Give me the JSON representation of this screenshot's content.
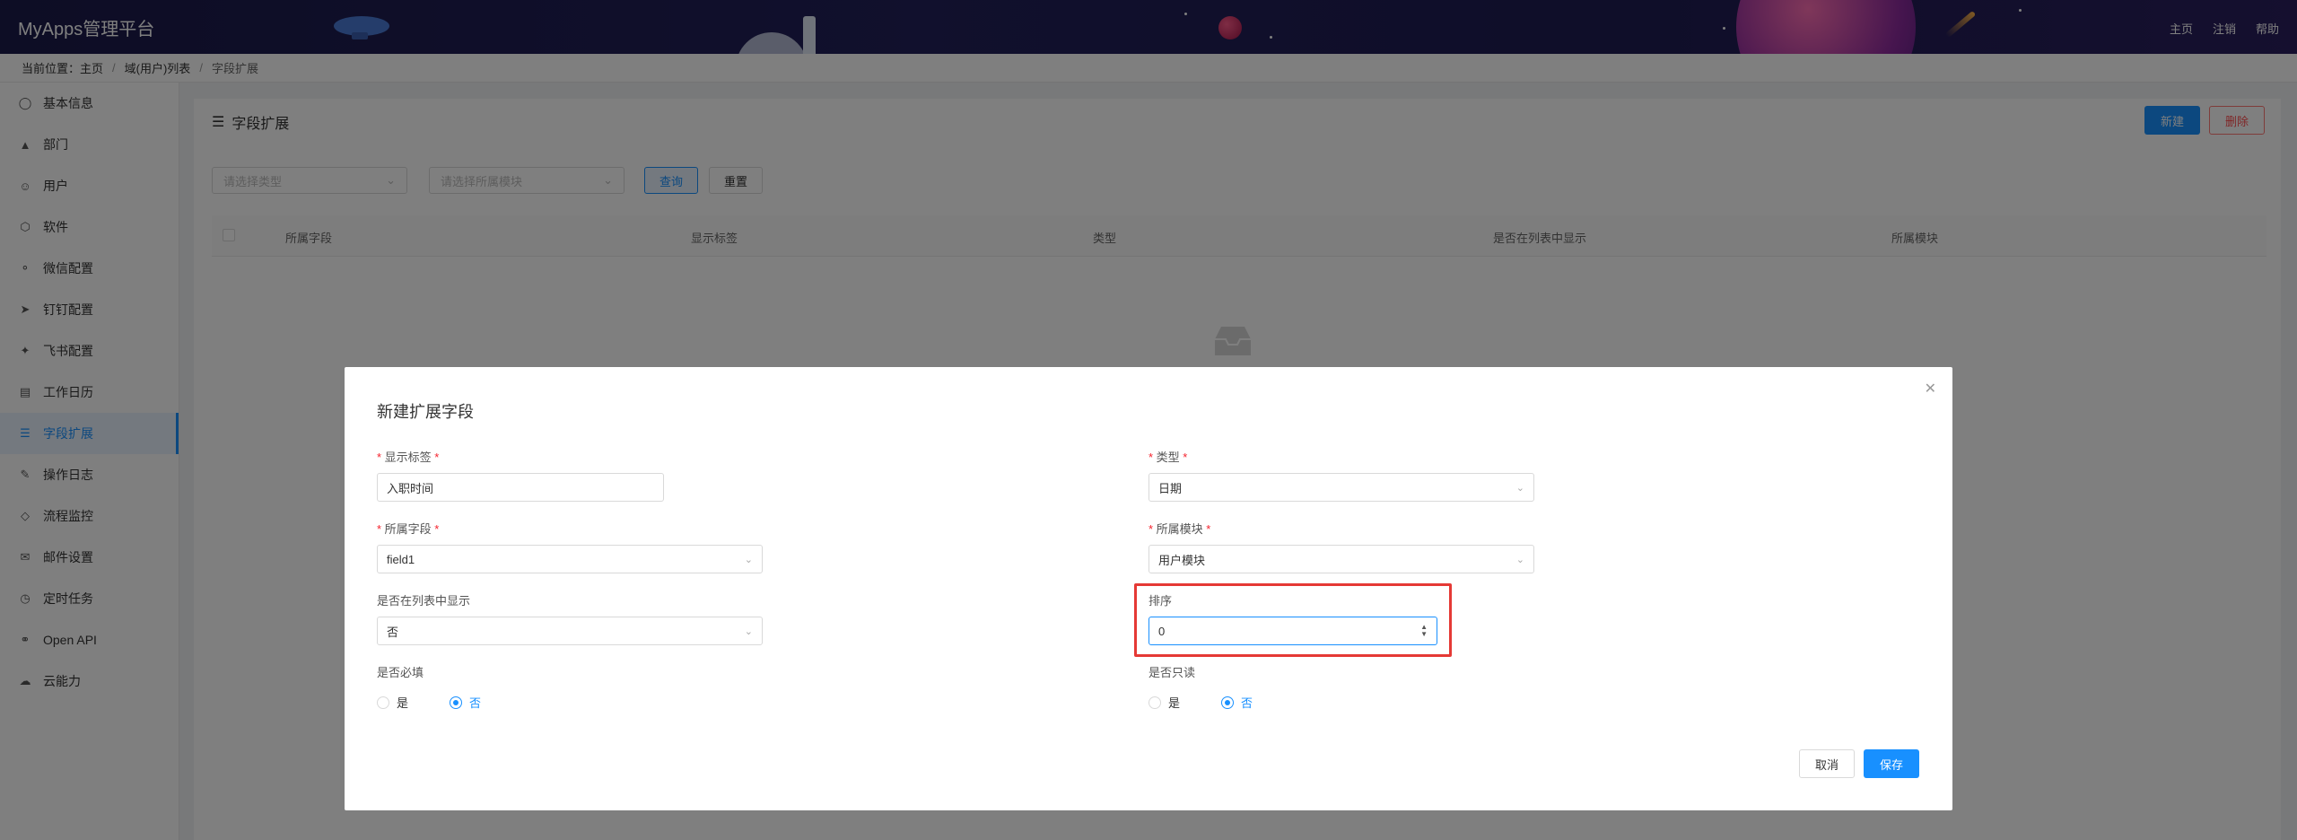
{
  "header": {
    "brand": "MyApps管理平台",
    "links": [
      "主页",
      "注销",
      "帮助"
    ]
  },
  "breadcrumb": {
    "prefix": "当前位置：主页",
    "items": [
      "域(用户)列表",
      "字段扩展"
    ]
  },
  "sidebar": {
    "items": [
      {
        "label": "基本信息",
        "icon": "user-icon"
      },
      {
        "label": "部门",
        "icon": "org-icon"
      },
      {
        "label": "用户",
        "icon": "users-icon"
      },
      {
        "label": "软件",
        "icon": "cube-icon"
      },
      {
        "label": "微信配置",
        "icon": "wechat-icon"
      },
      {
        "label": "钉钉配置",
        "icon": "dingtalk-icon"
      },
      {
        "label": "飞书配置",
        "icon": "feishu-icon"
      },
      {
        "label": "工作日历",
        "icon": "calendar-icon"
      },
      {
        "label": "字段扩展",
        "icon": "sliders-icon"
      },
      {
        "label": "操作日志",
        "icon": "log-icon"
      },
      {
        "label": "流程监控",
        "icon": "diamond-icon"
      },
      {
        "label": "邮件设置",
        "icon": "mail-icon"
      },
      {
        "label": "定时任务",
        "icon": "clock-icon"
      },
      {
        "label": "Open API",
        "icon": "link-icon"
      },
      {
        "label": "云能力",
        "icon": "cloud-icon"
      }
    ],
    "active_index": 8
  },
  "main": {
    "title": "字段扩展",
    "new_label": "新建",
    "delete_label": "删除",
    "filter_type_placeholder": "请选择类型",
    "filter_module_placeholder": "请选择所属模块",
    "query_label": "查询",
    "reset_label": "重置",
    "columns": [
      "所属字段",
      "显示标签",
      "类型",
      "是否在列表中显示",
      "所属模块"
    ]
  },
  "dialog": {
    "title": "新建扩展字段",
    "display_label": {
      "label": "显示标签",
      "value": "入职时间"
    },
    "type": {
      "label": "类型",
      "value": "日期"
    },
    "field": {
      "label": "所属字段",
      "value": "field1"
    },
    "module": {
      "label": "所属模块",
      "value": "用户模块"
    },
    "show_in_list": {
      "label": "是否在列表中显示",
      "value": "否"
    },
    "order": {
      "label": "排序",
      "value": "0"
    },
    "required": {
      "label": "是否必填",
      "options": [
        "是",
        "否"
      ],
      "selected": "否"
    },
    "readonly": {
      "label": "是否只读",
      "options": [
        "是",
        "否"
      ],
      "selected": "否"
    },
    "cancel_label": "取消",
    "save_label": "保存"
  },
  "colors": {
    "accent": "#1890ff",
    "danger": "#ff4d4f",
    "highlight": "#e53935"
  }
}
